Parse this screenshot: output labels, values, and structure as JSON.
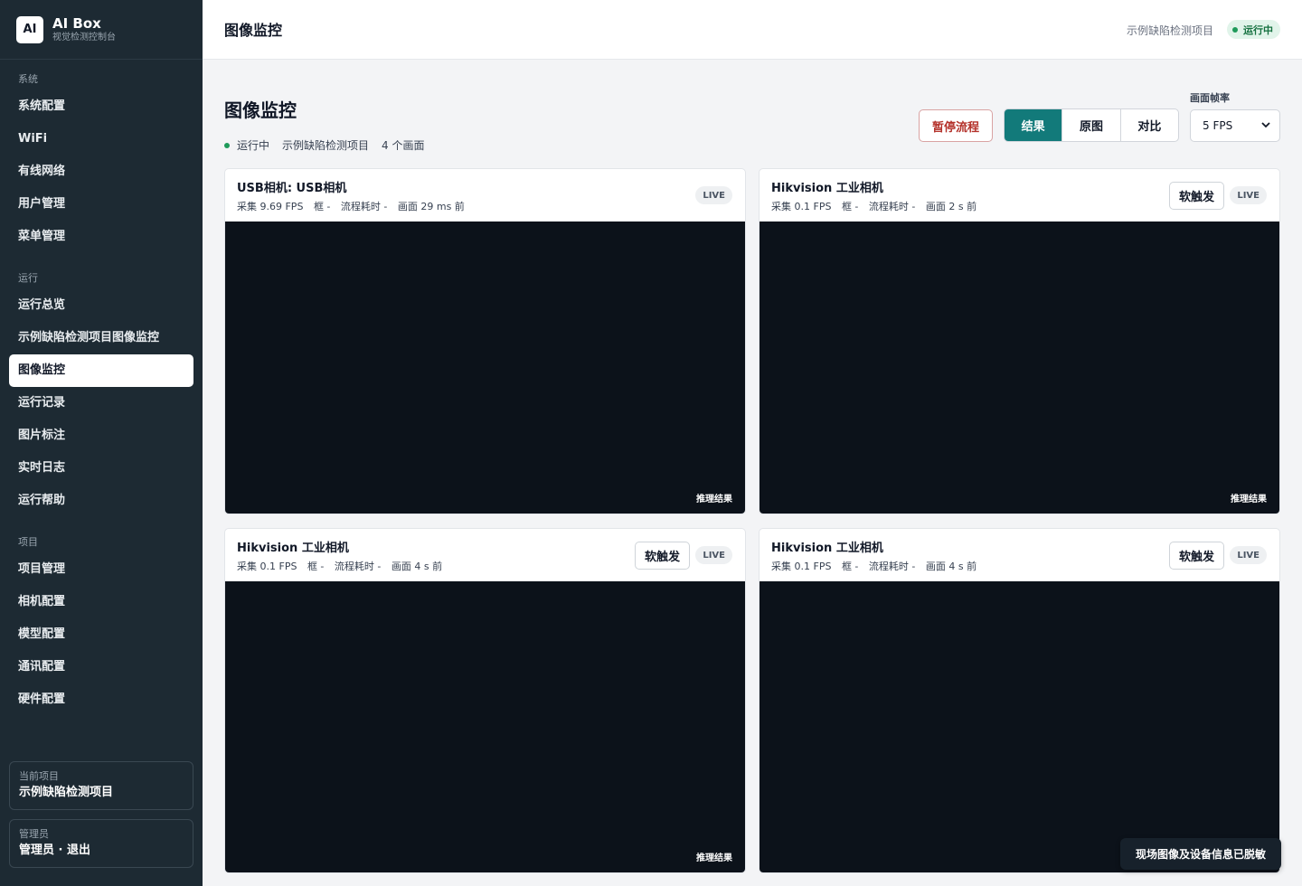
{
  "brand": {
    "logo": "AI",
    "title": "AI Box",
    "subtitle": "视觉检测控制台"
  },
  "sidebar": {
    "sections": [
      {
        "label": "系统",
        "items": [
          "系统配置",
          "WiFi",
          "有线网络",
          "用户管理",
          "菜单管理"
        ]
      },
      {
        "label": "运行",
        "items": [
          "运行总览",
          "示例缺陷检测项目图像监控",
          "图像监控",
          "运行记录",
          "图片标注",
          "实时日志",
          "运行帮助"
        ]
      },
      {
        "label": "项目",
        "items": [
          "项目管理",
          "相机配置",
          "模型配置",
          "通讯配置",
          "硬件配置"
        ]
      }
    ],
    "active_item": "图像监控",
    "current_project": {
      "label": "当前项目",
      "value": "示例缺陷检测项目"
    },
    "user": {
      "label": "管理员",
      "value": "管理员 · 退出"
    }
  },
  "topbar": {
    "title": "图像监控",
    "project": "示例缺陷检测项目",
    "status": "运行中",
    "status_color": "#1e9a5a"
  },
  "page": {
    "title": "图像监控",
    "meta": {
      "status": "运行中",
      "project": "示例缺陷检测项目",
      "count": "4 个画面"
    },
    "pause_button": "暂停流程",
    "view_modes": [
      "结果",
      "原图",
      "对比"
    ],
    "active_view_mode": "结果",
    "fps_label": "画面帧率",
    "fps_value": "5 FPS",
    "accent": "#127a7a"
  },
  "cameras": [
    {
      "title": "USB相机: USB相机",
      "fps": "采集 9.69 FPS",
      "boxes": "框 -",
      "latency": "流程耗时 -",
      "frame_age": "画面 29 ms 前",
      "live": "LIVE",
      "trigger": "",
      "overlay": "推理结果"
    },
    {
      "title": "Hikvision 工业相机",
      "fps": "采集 0.1 FPS",
      "boxes": "框 -",
      "latency": "流程耗时 -",
      "frame_age": "画面 2 s 前",
      "live": "LIVE",
      "trigger": "软触发",
      "overlay": "推理结果"
    },
    {
      "title": "Hikvision 工业相机",
      "fps": "采集 0.1 FPS",
      "boxes": "框 -",
      "latency": "流程耗时 -",
      "frame_age": "画面 4 s 前",
      "live": "LIVE",
      "trigger": "软触发",
      "overlay": "推理结果"
    },
    {
      "title": "Hikvision 工业相机",
      "fps": "采集 0.1 FPS",
      "boxes": "框 -",
      "latency": "流程耗时 -",
      "frame_age": "画面 4 s 前",
      "live": "LIVE",
      "trigger": "软触发",
      "overlay": ""
    }
  ],
  "toast": "现场图像及设备信息已脱敏"
}
